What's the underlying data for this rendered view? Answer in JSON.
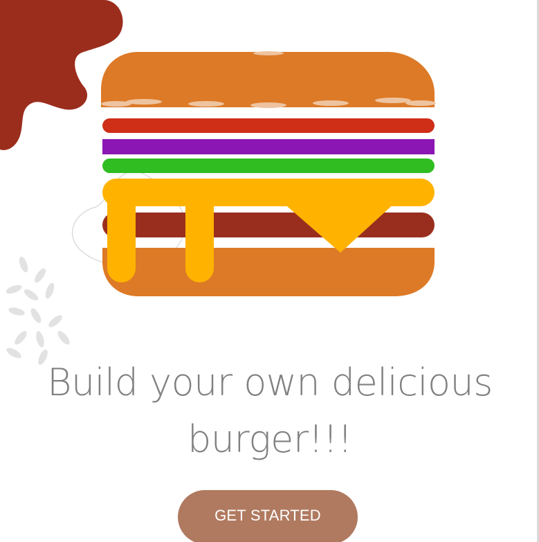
{
  "hero": {
    "headline": "Build your own delicious burger!!!"
  },
  "cta": {
    "label": "GET STARTED"
  },
  "colors": {
    "splash": "#9b2d1d",
    "bun": "#dd7a27",
    "sesame": "#eec4a0",
    "tomato": "#cf2e17",
    "onion": "#8b16b4",
    "lettuce": "#2fbd21",
    "cheese": "#ffb300",
    "patty": "#9a2e1e",
    "seeds": "#e2e2e2",
    "headline_text": "#808080",
    "button_bg": "#b07a60",
    "button_text": "#ffffff"
  },
  "icons": {
    "burger": "burger-illustration",
    "splash": "sauce-splash-decoration",
    "seeds": "sesame-seeds-decoration"
  }
}
